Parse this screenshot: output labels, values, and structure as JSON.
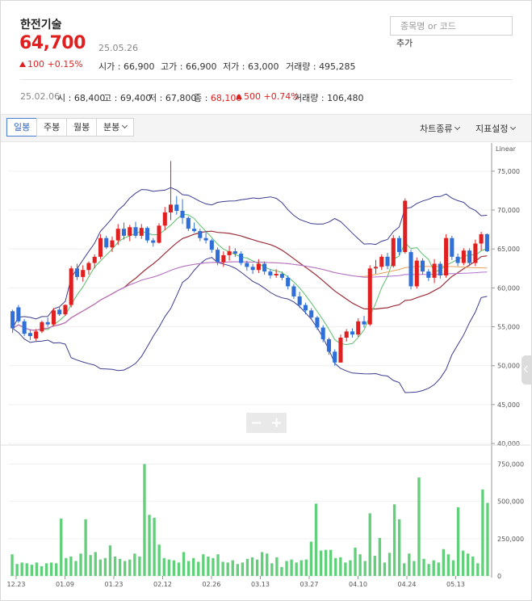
{
  "stock": {
    "name": "한전기술",
    "price": "64,700",
    "date": "25.05.26",
    "change": "100",
    "change_pct": "+0.15%",
    "open_label": "시가 : ",
    "open": "66,900",
    "high_label": "고가 : ",
    "high": "66,900",
    "low_label": "저가 : ",
    "low": "63,000",
    "vol_label": "거래량 : ",
    "volume": "495,285",
    "up_color": "#e02020",
    "down_color": "#2f6fd8"
  },
  "search": {
    "placeholder": "종목명 or 코드",
    "add_label": "추가"
  },
  "history": {
    "date": "25.02.06",
    "open_label": "시 : ",
    "open": "68,400",
    "high_label": "고 : ",
    "high": "69,400",
    "low_label": "저 : ",
    "low": "67,800",
    "close_label": "종 : ",
    "close": "68,100",
    "change": "500",
    "change_pct": "+0.74%",
    "vol_label": "거래량 : ",
    "volume": "106,480"
  },
  "toolbar": {
    "tabs": [
      "일봉",
      "주봉",
      "월봉",
      "분봉"
    ],
    "chart_type": "차트종류",
    "indicator": "지표설정"
  },
  "chart_data": {
    "type": "candlestick",
    "scale_label": "Linear",
    "price_ticks": [
      "75,000",
      "70,000",
      "65,000",
      "60,000",
      "55,000",
      "50,000",
      "45,000",
      "40,000"
    ],
    "volume_ticks": [
      "750,000",
      "500,000",
      "250,000",
      "0"
    ],
    "x_labels": [
      "12.23",
      "01.09",
      "01.23",
      "02.12",
      "02.26",
      "03.13",
      "03.27",
      "04.10",
      "04.24",
      "05.13"
    ],
    "ylim": [
      40000,
      78000
    ],
    "vlim": [
      0,
      850000
    ],
    "candles": [
      [
        57000,
        57200,
        54200,
        54800
      ],
      [
        57500,
        57800,
        55500,
        55700
      ],
      [
        55700,
        56000,
        53800,
        54100
      ],
      [
        54200,
        54600,
        53300,
        53800
      ],
      [
        53500,
        54700,
        53200,
        54400
      ],
      [
        54400,
        55800,
        54200,
        55600
      ],
      [
        55600,
        56200,
        55000,
        55300
      ],
      [
        55300,
        57400,
        55100,
        57100
      ],
      [
        57200,
        57600,
        56400,
        56600
      ],
      [
        56600,
        57900,
        56400,
        57800
      ],
      [
        57800,
        62800,
        57500,
        62500
      ],
      [
        62500,
        63100,
        61000,
        61400
      ],
      [
        61400,
        62900,
        60800,
        62300
      ],
      [
        62300,
        63400,
        61700,
        63200
      ],
      [
        63200,
        64300,
        62500,
        64000
      ],
      [
        64000,
        66900,
        63700,
        66400
      ],
      [
        66400,
        66700,
        65000,
        65200
      ],
      [
        65200,
        66600,
        64600,
        66100
      ],
      [
        66100,
        68200,
        65500,
        67600
      ],
      [
        67600,
        68400,
        66200,
        66700
      ],
      [
        66700,
        68100,
        66000,
        67800
      ],
      [
        67800,
        68500,
        66400,
        66700
      ],
      [
        66700,
        68200,
        66300,
        67700
      ],
      [
        67700,
        67900,
        65800,
        66100
      ],
      [
        66100,
        66400,
        65300,
        65800
      ],
      [
        65800,
        68300,
        65700,
        68000
      ],
      [
        68000,
        70400,
        67400,
        69700
      ],
      [
        69700,
        76300,
        68700,
        70700
      ],
      [
        70700,
        71800,
        69400,
        69900
      ],
      [
        69900,
        71400,
        68200,
        69000
      ],
      [
        69000,
        69200,
        67300,
        67600
      ],
      [
        67600,
        68400,
        67100,
        67300
      ],
      [
        67300,
        67600,
        66000,
        66400
      ],
      [
        66400,
        67300,
        65700,
        66100
      ],
      [
        66100,
        66300,
        64500,
        64900
      ],
      [
        64900,
        65200,
        62900,
        63300
      ],
      [
        63300,
        64700,
        62700,
        64200
      ],
      [
        64200,
        65400,
        63500,
        64700
      ],
      [
        64700,
        65100,
        64000,
        64400
      ],
      [
        64400,
        64700,
        62900,
        63200
      ],
      [
        63200,
        63500,
        62200,
        62700
      ],
      [
        62700,
        63100,
        61800,
        62300
      ],
      [
        62300,
        63700,
        61900,
        63100
      ],
      [
        63100,
        63400,
        61700,
        62100
      ],
      [
        62100,
        62400,
        61200,
        61600
      ],
      [
        61600,
        62400,
        61300,
        61800
      ],
      [
        61800,
        62100,
        61000,
        61300
      ],
      [
        61300,
        61600,
        59800,
        60200
      ],
      [
        60200,
        60500,
        58600,
        58900
      ],
      [
        58900,
        59500,
        57400,
        57800
      ],
      [
        57800,
        58100,
        56600,
        57100
      ],
      [
        57100,
        57400,
        55900,
        56200
      ],
      [
        56200,
        56400,
        54600,
        54900
      ],
      [
        54900,
        55200,
        53000,
        53400
      ],
      [
        53400,
        53600,
        51400,
        51800
      ],
      [
        51800,
        52100,
        50000,
        50400
      ],
      [
        50400,
        54000,
        52600,
        53600
      ],
      [
        53600,
        54700,
        53100,
        54400
      ],
      [
        54400,
        54800,
        53600,
        54000
      ],
      [
        54000,
        56100,
        53700,
        55700
      ],
      [
        55700,
        56400,
        54900,
        55300
      ],
      [
        55300,
        62900,
        55100,
        62500
      ],
      [
        62500,
        63600,
        61800,
        62700
      ],
      [
        62700,
        64300,
        62300,
        64000
      ],
      [
        64000,
        64500,
        62400,
        62800
      ],
      [
        62800,
        66800,
        62600,
        66400
      ],
      [
        66400,
        66700,
        64200,
        64600
      ],
      [
        64600,
        71500,
        64400,
        71200
      ],
      [
        64600,
        64900,
        59800,
        60200
      ],
      [
        60200,
        63900,
        59900,
        63500
      ],
      [
        63500,
        63800,
        61700,
        62100
      ],
      [
        62100,
        62400,
        60900,
        61300
      ],
      [
        61300,
        63700,
        60600,
        63100
      ],
      [
        63100,
        63400,
        61200,
        61600
      ],
      [
        61600,
        66900,
        61300,
        66400
      ],
      [
        66400,
        66700,
        63600,
        64000
      ],
      [
        64000,
        64400,
        62800,
        63200
      ],
      [
        63200,
        65100,
        62900,
        64800
      ],
      [
        64800,
        65100,
        62800,
        63200
      ],
      [
        63200,
        66200,
        62800,
        65700
      ],
      [
        65700,
        67200,
        64800,
        66900
      ],
      [
        66900,
        67000,
        64600,
        64700
      ]
    ],
    "volumes": [
      145000,
      80000,
      90000,
      85000,
      75000,
      90000,
      65000,
      85000,
      90000,
      85000,
      385000,
      120000,
      130000,
      100000,
      150000,
      380000,
      140000,
      160000,
      110000,
      120000,
      205000,
      130000,
      115000,
      100000,
      110000,
      150000,
      130000,
      750000,
      410000,
      390000,
      210000,
      120000,
      110000,
      105000,
      90000,
      160000,
      100000,
      120000,
      95000,
      145000,
      130000,
      120000,
      145000,
      95000,
      90000,
      105000,
      80000,
      90000,
      115000,
      125000,
      110000,
      160000,
      150000,
      85000,
      125000,
      60000,
      100000,
      110000,
      90000,
      105000,
      110000,
      230000,
      485000,
      170000,
      175000,
      175000,
      120000,
      125000,
      90000,
      105000,
      190000,
      145000,
      100000,
      420000,
      135000,
      255000,
      90000,
      155000,
      480000,
      380000,
      85000,
      150000,
      100000,
      660000,
      115000,
      80000,
      105000,
      90000,
      180000,
      145000,
      105000,
      460000,
      170000,
      150000,
      130000,
      85000,
      580000,
      490000
    ]
  }
}
